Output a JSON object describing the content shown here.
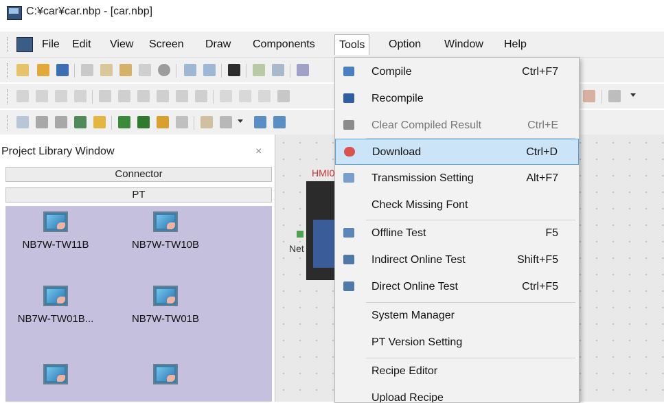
{
  "window": {
    "title": "C:¥car¥car.nbp - [car.nbp]"
  },
  "menubar": {
    "items": [
      {
        "label": "File"
      },
      {
        "label": "Edit"
      },
      {
        "label": "View"
      },
      {
        "label": "Screen"
      },
      {
        "label": "Draw"
      },
      {
        "label": "Components"
      },
      {
        "label": "Tools"
      },
      {
        "label": "Option"
      },
      {
        "label": "Window"
      },
      {
        "label": "Help"
      }
    ],
    "active": "Tools"
  },
  "project_panel": {
    "title": "Project Library Window",
    "close": "×",
    "groups": [
      "Connector",
      "PT"
    ],
    "devices": [
      {
        "label": "NB7W-TW11B"
      },
      {
        "label": "NB7W-TW10B"
      },
      {
        "label": "NB7W-TW01B..."
      },
      {
        "label": "NB7W-TW01B"
      },
      {
        "label": ""
      },
      {
        "label": ""
      }
    ]
  },
  "canvas": {
    "hmi_label": "HMI0",
    "net_label": "Net"
  },
  "tools_menu": {
    "items": [
      {
        "label": "Compile",
        "shortcut": "Ctrl+F7",
        "icon": "compile-icon",
        "disabled": false
      },
      {
        "label": "Recompile",
        "shortcut": "",
        "icon": "recompile-icon",
        "disabled": false
      },
      {
        "label": "Clear Compiled Result",
        "shortcut": "Ctrl+E",
        "icon": "clear-compiled-icon",
        "disabled": true
      },
      {
        "label": "Download",
        "shortcut": "Ctrl+D",
        "icon": "download-icon",
        "disabled": false,
        "highlighted": true
      },
      {
        "label": "Transmission Setting",
        "shortcut": "Alt+F7",
        "icon": "transmission-icon",
        "disabled": false
      },
      {
        "label": "Check Missing Font",
        "shortcut": "",
        "icon": "",
        "disabled": false
      },
      {
        "label": "Offline Test",
        "shortcut": "F5",
        "icon": "offline-test-icon",
        "disabled": false
      },
      {
        "label": "Indirect Online Test",
        "shortcut": "Shift+F5",
        "icon": "indirect-online-test-icon",
        "disabled": false
      },
      {
        "label": "Direct Online Test",
        "shortcut": "Ctrl+F5",
        "icon": "direct-online-test-icon",
        "disabled": false
      },
      {
        "label": "System Manager",
        "shortcut": "",
        "icon": "",
        "disabled": false
      },
      {
        "label": "PT Version Setting",
        "shortcut": "",
        "icon": "",
        "disabled": false
      },
      {
        "label": "Recipe Editor",
        "shortcut": "",
        "icon": "",
        "disabled": false
      },
      {
        "label": "Upload Recipe",
        "shortcut": "",
        "icon": "",
        "disabled": false
      }
    ]
  },
  "colors": {
    "accent_highlight": "#cce4f7",
    "highlight_border": "#5aa0d8",
    "panel_device_bg": "#c4c0dd",
    "hmi_label": "#cc3333"
  }
}
